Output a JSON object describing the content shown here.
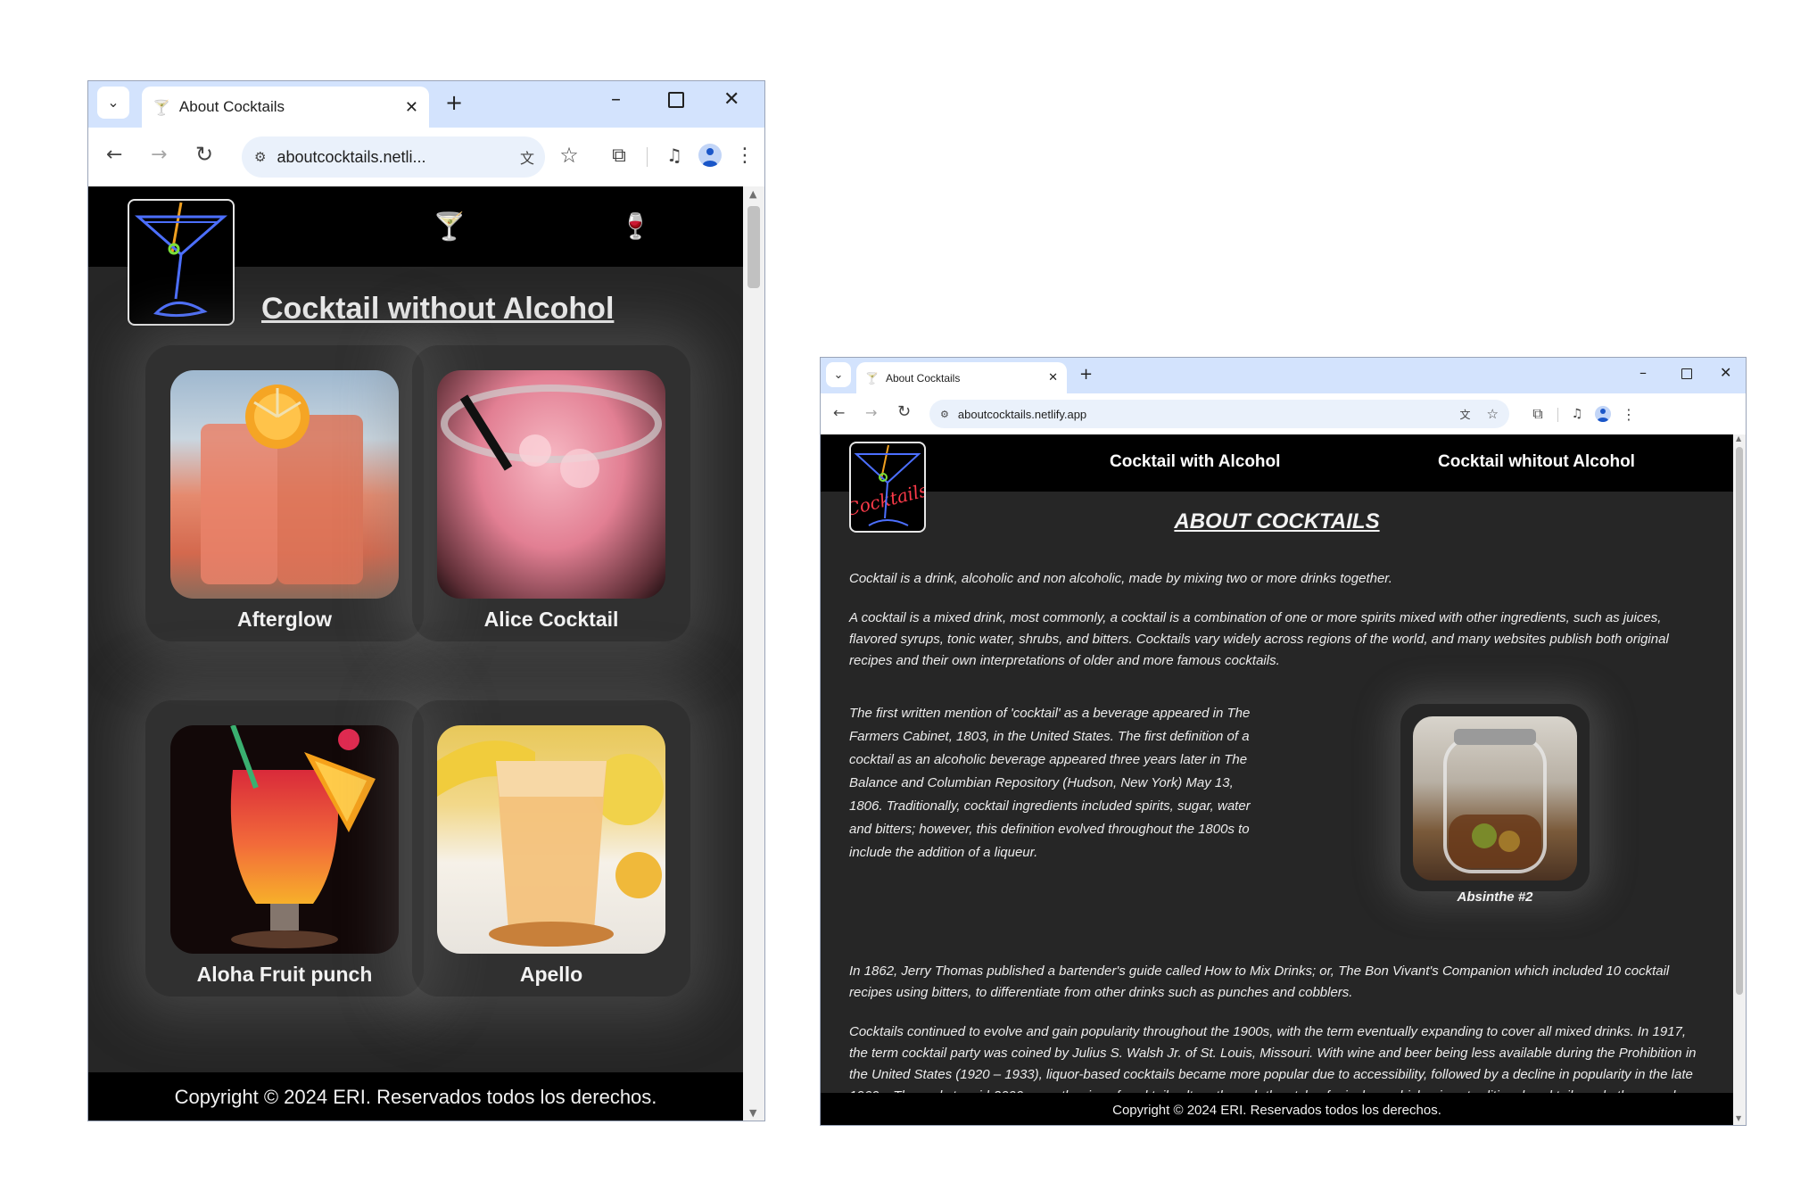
{
  "windows": {
    "left": {
      "tab_title": "About Cocktails",
      "url": "aboutcocktails.netli...",
      "nav_icon_1": "martini-glass-icon",
      "nav_icon_2": "wine-glass-icon",
      "heading": "Cocktail without Alcohol",
      "cards": [
        {
          "name": "Afterglow"
        },
        {
          "name": "Alice Cocktail"
        },
        {
          "name": "Aloha Fruit punch"
        },
        {
          "name": "Apello"
        }
      ],
      "footer": "Copyright © 2024 ERI. Reservados todos los derechos."
    },
    "right": {
      "tab_title": "About Cocktails",
      "url": "aboutcocktails.netlify.app",
      "logo_text": "Cocktails",
      "nav": {
        "with_alcohol": "Cocktail with Alcohol",
        "without_alcohol": "Cocktail whitout Alcohol"
      },
      "heading": "ABOUT COCKTAILS",
      "p1": "Cocktail is a drink, alcoholic and non alcoholic, made by mixing two or more drinks together.",
      "p2": "A cocktail is a mixed drink, most commonly, a cocktail is a combination of one or more spirits mixed with other ingredients, such as juices, flavored syrups, tonic water, shrubs, and bitters. Cocktails vary widely across regions of the world, and many websites publish both original recipes and their own interpretations of older and more famous cocktails.",
      "p3": "The first written mention of 'cocktail' as a beverage appeared in The Farmers Cabinet, 1803, in the United States. The first definition of a cocktail as an alcoholic beverage appeared three years later in The Balance and Columbian Repository (Hudson, New York) May 13, 1806. Traditionally, cocktail ingredients included spirits, sugar, water and bitters; however, this definition evolved throughout the 1800s to include the addition of a liqueur.",
      "figure_caption": "Absinthe #2",
      "p4": "In 1862, Jerry Thomas published a bartender's guide called How to Mix Drinks; or, The Bon Vivant's Companion which included 10 cocktail recipes using bitters, to differentiate from other drinks such as punches and cobblers.",
      "p5": "Cocktails continued to evolve and gain popularity throughout the 1900s, with the term eventually expanding to cover all mixed drinks. In 1917, the term cocktail party was coined by Julius S. Walsh Jr. of St. Louis, Missouri. With wine and beer being less available during the Prohibition in the United States (1920 – 1933), liquor-based cocktails became more popular due to accessibility, followed by a decline in popularity in the late 1960s. The early to mid-2000s saw the rise of cocktail culture through the style of mixology which mixes traditional cocktails and other novel ingredients.",
      "footer": "Copyright © 2024 ERI. Reservados todos los derechos."
    }
  },
  "colors": {
    "tabstrip": "#d3e3fd",
    "page_bg": "#262626",
    "header_bg": "#000000",
    "text": "#f2f2f2",
    "neon_blue": "#4c6fff",
    "neon_red": "#ff3b4a",
    "neon_green": "#7adf3a"
  }
}
